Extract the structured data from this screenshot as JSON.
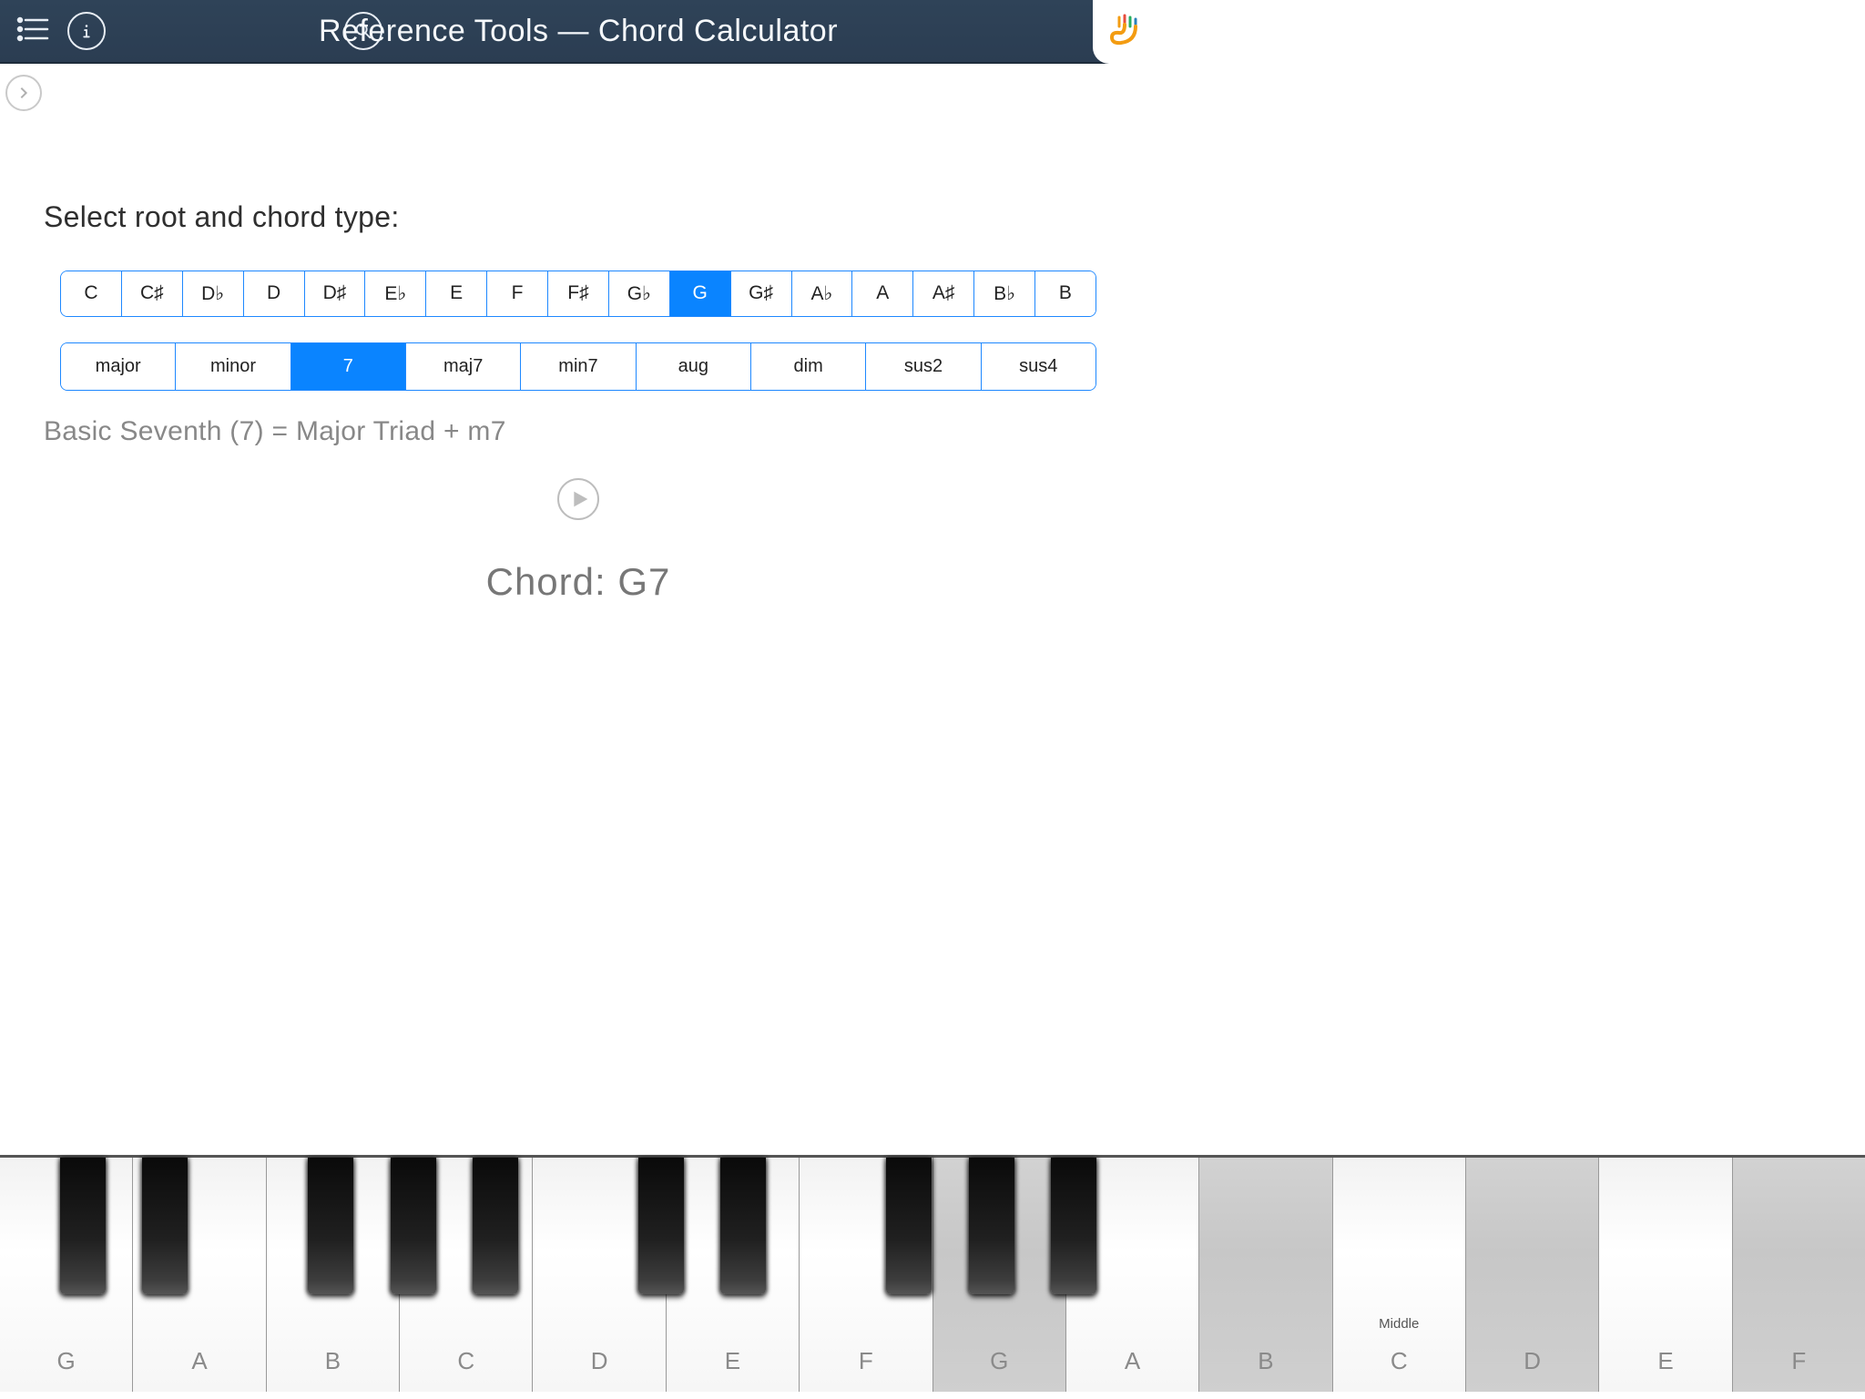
{
  "header": {
    "title": "Reference Tools — Chord Calculator"
  },
  "prompt": "Select root and chord type:",
  "roots": {
    "items": [
      "C",
      "C♯",
      "D♭",
      "D",
      "D♯",
      "E♭",
      "E",
      "F",
      "F♯",
      "G♭",
      "G",
      "G♯",
      "A♭",
      "A",
      "A♯",
      "B♭",
      "B"
    ],
    "selected_index": 10
  },
  "types": {
    "items": [
      "major",
      "minor",
      "7",
      "maj7",
      "min7",
      "aug",
      "dim",
      "sus2",
      "sus4"
    ],
    "selected_index": 2
  },
  "description": "Basic Seventh (7) = Major Triad + m7",
  "chord_label_prefix": "Chord: ",
  "chord_name": "G7",
  "keyboard": {
    "white_keys": [
      {
        "label": "G",
        "highlighted": false
      },
      {
        "label": "A",
        "highlighted": false
      },
      {
        "label": "B",
        "highlighted": false
      },
      {
        "label": "C",
        "highlighted": false
      },
      {
        "label": "D",
        "highlighted": false
      },
      {
        "label": "E",
        "highlighted": false
      },
      {
        "label": "F",
        "highlighted": false
      },
      {
        "label": "G",
        "highlighted": true
      },
      {
        "label": "A",
        "highlighted": false
      },
      {
        "label": "B",
        "highlighted": true
      },
      {
        "label": "C",
        "highlighted": false,
        "middle": true,
        "middle_label": "Middle"
      },
      {
        "label": "D",
        "highlighted": true
      },
      {
        "label": "E",
        "highlighted": false
      },
      {
        "label": "F",
        "highlighted": true
      }
    ],
    "black_key_after_white_index": [
      0,
      1,
      3,
      4,
      5,
      7,
      8,
      10,
      11,
      12
    ]
  }
}
